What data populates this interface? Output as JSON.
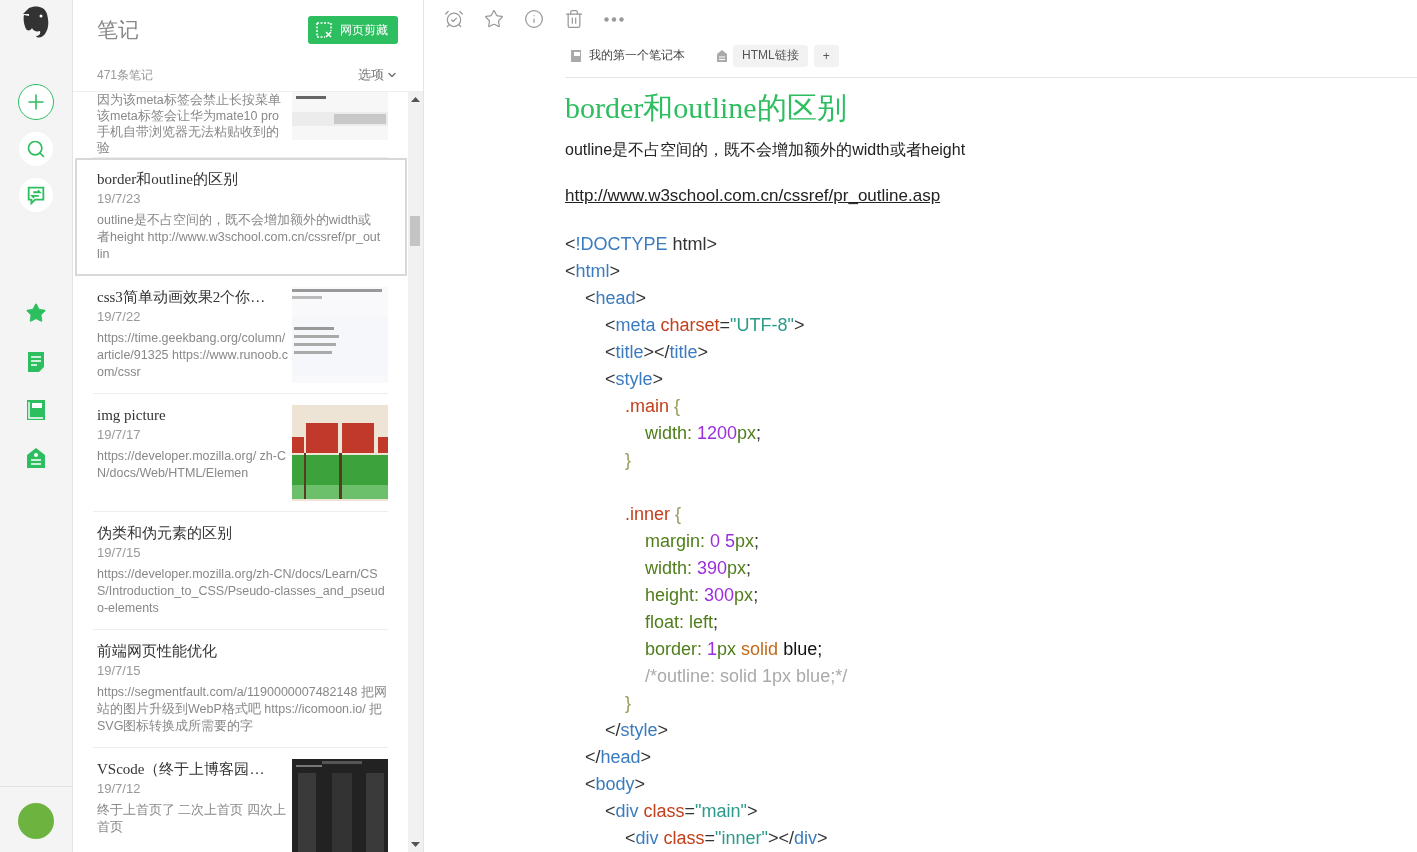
{
  "sidebar": {
    "nav": [
      {
        "kind": "new"
      },
      {
        "kind": "search"
      },
      {
        "kind": "share"
      },
      {
        "kind": "shortcuts"
      },
      {
        "kind": "notes"
      },
      {
        "kind": "notebooks"
      },
      {
        "kind": "tags"
      }
    ]
  },
  "note_list": {
    "title": "笔记",
    "clip_button": "网页剪藏",
    "count": "471条笔记",
    "options": "选项",
    "notes": [
      {
        "snippet": "因为该meta标签会禁止长按菜单该meta标签会让华为mate10 pro手机自带浏览器无法粘贴收到的验",
        "selected": false
      },
      {
        "title": "border和outline的区别",
        "date": "19/7/23",
        "snippet": "outline是不占空间的，既不会增加额外的width或者height http://www.w3school.com.cn/cssref/pr_outlin",
        "selected": true
      },
      {
        "title": "css3简单动画效果2个你…",
        "date": "19/7/22",
        "snippet": "https://time.geekbang.org/column/article/91325 https://www.runoob.com/cssr",
        "selected": false
      },
      {
        "title": "img picture",
        "date": "19/7/17",
        "snippet": "https://developer.mozilla.org/ zh-CN/docs/Web/HTML/Elemen",
        "selected": false
      },
      {
        "title": "伪类和伪元素的区别",
        "date": "19/7/15",
        "snippet": "https://developer.mozilla.org/zh-CN/docs/Learn/CSS/Introduction_to_CSS/Pseudo-classes_and_pseudo-elements",
        "selected": false
      },
      {
        "title": "前端网页性能优化",
        "date": "19/7/15",
        "snippet": "https://segmentfault.com/a/1190000007482148 把网站的图片升级到WebP格式吧 https://icomoon.io/ 把SVG图标转换成所需要的字",
        "selected": false
      },
      {
        "title": "VScode（终于上博客园…",
        "date": "19/7/12",
        "snippet": "终于上首页了 二次上首页 四次上首页",
        "selected": false
      }
    ]
  },
  "editor": {
    "toolbar": [
      {
        "kind": "reminder"
      },
      {
        "kind": "star"
      },
      {
        "kind": "info"
      },
      {
        "kind": "delete"
      },
      {
        "kind": "more"
      }
    ],
    "notebook": "我的第一个笔记本",
    "tags": [
      "HTML链接"
    ],
    "add_tag": "+",
    "title": "border和outline的区别",
    "paragraph": "outline是不占空间的，既不会增加额外的width或者height",
    "link": "http://www.w3school.com.cn/cssref/pr_outline.asp",
    "code": [
      {
        "tokens": [
          {
            "kind": "punct",
            "text": "<"
          },
          {
            "kind": "tag",
            "text": "!DOCTYPE"
          },
          {
            "kind": "punct",
            "text": " html>"
          }
        ]
      },
      {
        "tokens": [
          {
            "kind": "punct",
            "text": "<"
          },
          {
            "kind": "tag",
            "text": "html"
          },
          {
            "kind": "punct",
            "text": ">"
          }
        ]
      },
      {
        "tokens": [
          {
            "kind": "punct",
            "text": "    <"
          },
          {
            "kind": "tag",
            "text": "head"
          },
          {
            "kind": "punct",
            "text": ">"
          }
        ]
      },
      {
        "tokens": [
          {
            "kind": "punct",
            "text": "        <"
          },
          {
            "kind": "tag",
            "text": "meta"
          },
          {
            "kind": "attr",
            "text": " charset"
          },
          {
            "kind": "punct",
            "text": "="
          },
          {
            "kind": "string",
            "text": "\"UTF-8\""
          },
          {
            "kind": "punct",
            "text": ">"
          }
        ]
      },
      {
        "tokens": [
          {
            "kind": "punct",
            "text": "        <"
          },
          {
            "kind": "tag",
            "text": "title"
          },
          {
            "kind": "punct",
            "text": "></"
          },
          {
            "kind": "tag",
            "text": "title"
          },
          {
            "kind": "punct",
            "text": ">"
          }
        ]
      },
      {
        "tokens": [
          {
            "kind": "punct",
            "text": "        <"
          },
          {
            "kind": "tag",
            "text": "style"
          },
          {
            "kind": "punct",
            "text": ">"
          }
        ]
      },
      {
        "tokens": [
          {
            "kind": "selector",
            "text": "            .main"
          },
          {
            "kind": "brace",
            "text": " {"
          }
        ]
      },
      {
        "tokens": [
          {
            "kind": "prop",
            "text": "                width: "
          },
          {
            "kind": "number",
            "text": "1200"
          },
          {
            "kind": "prop",
            "text": "px"
          },
          {
            "kind": "punct",
            "text": ";"
          }
        ]
      },
      {
        "tokens": [
          {
            "kind": "brace",
            "text": "            }"
          }
        ]
      },
      {
        "kind": "blank"
      },
      {
        "tokens": [
          {
            "kind": "selector",
            "text": "            .inner"
          },
          {
            "kind": "brace",
            "text": " {"
          }
        ]
      },
      {
        "tokens": [
          {
            "kind": "prop",
            "text": "                margin: "
          },
          {
            "kind": "number",
            "text": "0 5"
          },
          {
            "kind": "prop",
            "text": "px"
          },
          {
            "kind": "punct",
            "text": ";"
          }
        ]
      },
      {
        "tokens": [
          {
            "kind": "prop",
            "text": "                width: "
          },
          {
            "kind": "number",
            "text": "390"
          },
          {
            "kind": "prop",
            "text": "px"
          },
          {
            "kind": "punct",
            "text": ";"
          }
        ]
      },
      {
        "tokens": [
          {
            "kind": "prop",
            "text": "                height: "
          },
          {
            "kind": "number",
            "text": "300"
          },
          {
            "kind": "prop",
            "text": "px"
          },
          {
            "kind": "punct",
            "text": ";"
          }
        ]
      },
      {
        "tokens": [
          {
            "kind": "prop",
            "text": "                float: left"
          },
          {
            "kind": "punct",
            "text": ";"
          }
        ]
      },
      {
        "tokens": [
          {
            "kind": "prop",
            "text": "                border: "
          },
          {
            "kind": "number",
            "text": "1"
          },
          {
            "kind": "prop",
            "text": "px"
          },
          {
            "kind": "keyword",
            "text": " solid"
          },
          {
            "kind": "plain",
            "text": " blue;"
          }
        ]
      },
      {
        "tokens": [
          {
            "kind": "comment",
            "text": "                /*outline: solid 1px blue;*/"
          }
        ]
      },
      {
        "tokens": [
          {
            "kind": "brace",
            "text": "            }"
          }
        ]
      },
      {
        "tokens": [
          {
            "kind": "punct",
            "text": "        </"
          },
          {
            "kind": "tag",
            "text": "style"
          },
          {
            "kind": "punct",
            "text": ">"
          }
        ]
      },
      {
        "tokens": [
          {
            "kind": "punct",
            "text": "    </"
          },
          {
            "kind": "tag",
            "text": "head"
          },
          {
            "kind": "punct",
            "text": ">"
          }
        ]
      },
      {
        "tokens": [
          {
            "kind": "punct",
            "text": "    <"
          },
          {
            "kind": "tag",
            "text": "body"
          },
          {
            "kind": "punct",
            "text": ">"
          }
        ]
      },
      {
        "tokens": [
          {
            "kind": "punct",
            "text": "        <"
          },
          {
            "kind": "tag",
            "text": "div"
          },
          {
            "kind": "attr",
            "text": " class"
          },
          {
            "kind": "punct",
            "text": "="
          },
          {
            "kind": "string",
            "text": "\"main\""
          },
          {
            "kind": "punct",
            "text": ">"
          }
        ]
      },
      {
        "tokens": [
          {
            "kind": "punct",
            "text": "            <"
          },
          {
            "kind": "tag",
            "text": "div"
          },
          {
            "kind": "attr",
            "text": " class"
          },
          {
            "kind": "punct",
            "text": "="
          },
          {
            "kind": "string",
            "text": "\"inner\""
          },
          {
            "kind": "punct",
            "text": "></"
          },
          {
            "kind": "tag",
            "text": "div"
          },
          {
            "kind": "punct",
            "text": ">"
          }
        ]
      }
    ]
  }
}
